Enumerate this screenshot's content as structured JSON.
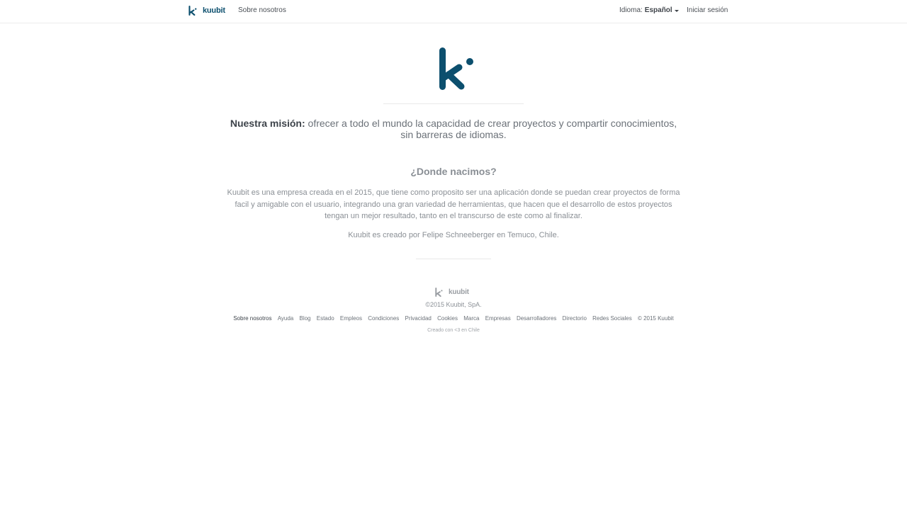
{
  "navbar": {
    "brand_name": "kuubit",
    "about_link": "Sobre nosotros",
    "language_label": "Idioma:",
    "language_value": "Español",
    "login_link": "Iniciar sesión"
  },
  "mission": {
    "label": "Nuestra misión:",
    "text": " ofrecer a todo el mundo la capacidad de crear proyectos y compartir conocimientos, sin barreras de idiomas."
  },
  "origin": {
    "title": "¿Donde nacimos?",
    "body": "Kuubit es una empresa creada en el 2015, que tiene como proposito ser una aplicación donde se puedan crear proyectos de forma facil y amigable con el usuario, integrando una gran variedad de herramientas, que hacen que el desarrollo de estos proyectos tengan un mejor resultado, tanto en el transcurso de este como al finalizar.",
    "credit": "Kuubit es creado por Felipe Schneeberger en Temuco, Chile."
  },
  "footer": {
    "brand_name": "kuubit",
    "copyright": "©2015 Kuubit, SpA.",
    "links": [
      {
        "label": "Sobre nosotros"
      },
      {
        "label": "Ayuda"
      },
      {
        "label": "Blog"
      },
      {
        "label": "Estado"
      },
      {
        "label": "Empleos"
      },
      {
        "label": "Condiciones"
      },
      {
        "label": "Privacidad"
      },
      {
        "label": "Cookies"
      },
      {
        "label": "Marca"
      },
      {
        "label": "Empresas"
      },
      {
        "label": "Desarrolladores"
      },
      {
        "label": "Directorio"
      },
      {
        "label": "Redes Sociales"
      }
    ],
    "copyright_short": "© 2015 Kuubit",
    "made_with": "Creado con <3 en Chile"
  },
  "colors": {
    "brand": "#0c4f6e",
    "text": "#6b7178",
    "text_dark": "#3d434a",
    "divider": "#e9e9e9"
  }
}
